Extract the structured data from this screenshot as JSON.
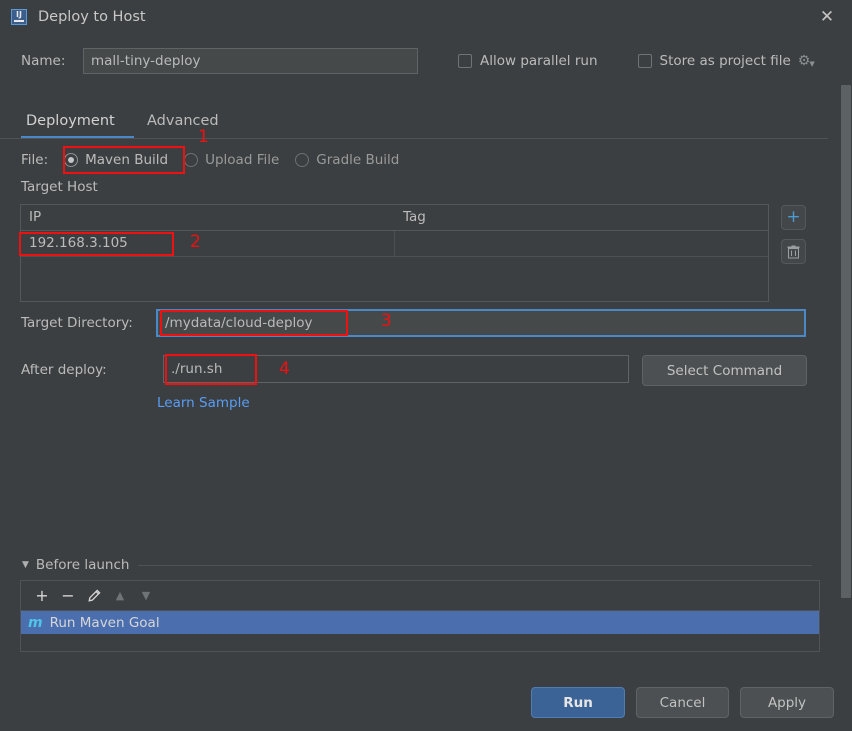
{
  "window": {
    "title": "Deploy to Host",
    "app_icon": "intellij-idea-icon",
    "close_label": "✕"
  },
  "name_row": {
    "label": "Name:",
    "value": "mall-tiny-deploy",
    "placeholder": "",
    "allow_parallel_run": "Allow parallel run",
    "store_as_project_file": "Store as project file",
    "gear_icon": "gear-icon"
  },
  "tabs": [
    {
      "label": "Deployment",
      "active": true
    },
    {
      "label": "Advanced",
      "active": false
    }
  ],
  "file_row": {
    "label": "File:",
    "options": [
      {
        "label": "Maven Build",
        "selected": true
      },
      {
        "label": "Upload File",
        "selected": false
      },
      {
        "label": "Gradle Build",
        "selected": false
      }
    ]
  },
  "target_host": {
    "section_label": "Target Host",
    "columns": [
      "IP",
      "Tag"
    ],
    "rows": [
      {
        "ip": "192.168.3.105",
        "tag": ""
      }
    ],
    "add_icon": "plus-icon",
    "delete_icon": "trash-icon"
  },
  "target_directory": {
    "label": "Target Directory:",
    "value": "/mydata/cloud-deploy",
    "placeholder": ""
  },
  "after_deploy": {
    "label": "After deploy:",
    "value": "./run.sh",
    "placeholder": "",
    "select_command_label": "Select Command",
    "learn_sample_label": "Learn Sample"
  },
  "before_launch": {
    "title": "Before launch",
    "collapse_arrow": "▼",
    "toolbar": {
      "add": "+",
      "remove": "−",
      "edit": "✐",
      "move_up": "▲",
      "move_down": "▼"
    },
    "items": [
      {
        "icon": "maven-icon",
        "icon_glyph": "m",
        "label": "Run Maven Goal",
        "selected": true
      }
    ]
  },
  "footer": {
    "run_label": "Run",
    "cancel_label": "Cancel",
    "apply_label": "Apply"
  },
  "annotations": [
    {
      "number": "1"
    },
    {
      "number": "2"
    },
    {
      "number": "3"
    },
    {
      "number": "4"
    }
  ],
  "colors": {
    "dialog_bg": "#3c3f41",
    "accent_blue": "#4a88c7",
    "selection_blue": "#4b6eaf",
    "link_blue": "#589df6",
    "annotation_red": "#ee1111",
    "maven_cyan": "#4fc3e8"
  }
}
